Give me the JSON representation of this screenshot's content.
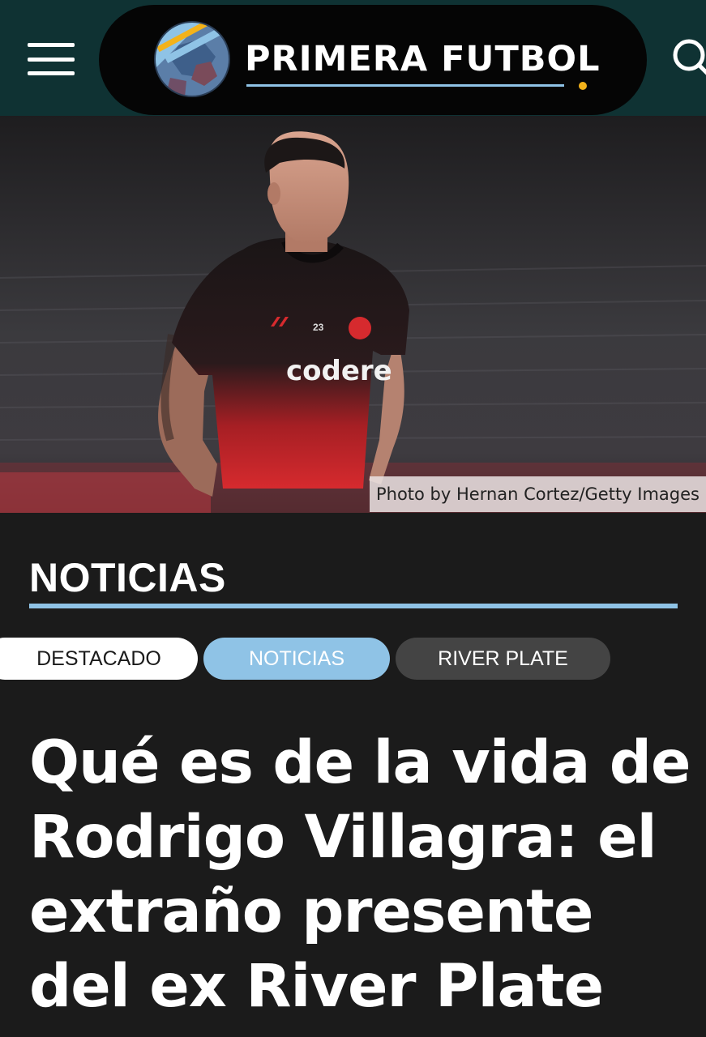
{
  "header": {
    "menu_icon": "hamburger-icon",
    "logo_icon": "football-ball-icon",
    "brand": "PRIMERA FUTBOL",
    "search_icon": "search-icon",
    "colors": {
      "bar": "#0f3233",
      "pill": "#050505",
      "accent": "#8fc3e6",
      "dot": "#f3b21a"
    }
  },
  "hero": {
    "jersey_number": "23",
    "sponsor": "codere",
    "photo_credit": "Photo by Hernan Cortez/Getty Images"
  },
  "section": {
    "title": "NOTICIAS"
  },
  "tags": [
    {
      "label": "DESTACADO"
    },
    {
      "label": "NOTICIAS"
    },
    {
      "label": "RIVER PLATE"
    }
  ],
  "article": {
    "headline": "Qué es de la vida de Rodrigo Villagra: el extraño presente del ex River Plate"
  }
}
